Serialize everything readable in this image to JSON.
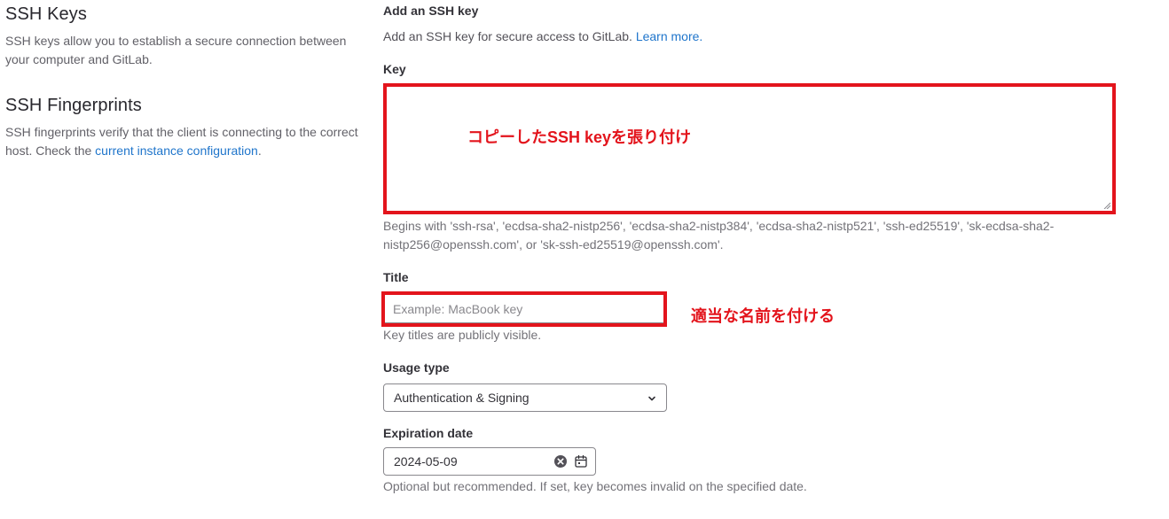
{
  "left": {
    "ssh_keys": {
      "title": "SSH Keys",
      "desc": "SSH keys allow you to establish a secure connection between your computer and GitLab."
    },
    "fingerprints": {
      "title": "SSH Fingerprints",
      "desc_before": "SSH fingerprints verify that the client is connecting to the correct host. Check the ",
      "link": "current instance configuration",
      "desc_after": "."
    }
  },
  "form": {
    "heading": "Add an SSH key",
    "desc": "Add an SSH key for secure access to GitLab.",
    "learn_more": "Learn more.",
    "key_label": "Key",
    "key_help": "Begins with 'ssh-rsa', 'ecdsa-sha2-nistp256', 'ecdsa-sha2-nistp384', 'ecdsa-sha2-nistp521', 'ssh-ed25519', 'sk-ecdsa-sha2-nistp256@openssh.com', or 'sk-ssh-ed25519@openssh.com'.",
    "title_label": "Title",
    "title_placeholder": "Example: MacBook key",
    "title_help": "Key titles are publicly visible.",
    "usage_label": "Usage type",
    "usage_value": "Authentication & Signing",
    "expiration_label": "Expiration date",
    "expiration_value": "2024-05-09",
    "expiration_help": "Optional but recommended. If set, key becomes invalid on the specified date."
  },
  "annotations": {
    "key_note": "コピーしたSSH keyを張り付け",
    "title_note": "適当な名前を付ける"
  },
  "colors": {
    "annotation": "#e3141c",
    "link": "#1f75cb"
  }
}
